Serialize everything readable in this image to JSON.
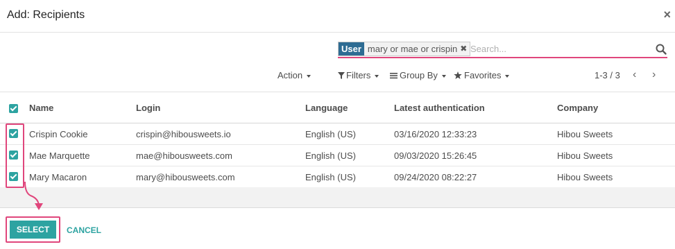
{
  "dialog": {
    "title": "Add: Recipients",
    "close_glyph": "×"
  },
  "search": {
    "facet_label": "User",
    "facet_values": "mary or mae or crispin",
    "facet_remove_glyph": "✖",
    "placeholder": "Search..."
  },
  "controls": {
    "action": "Action",
    "filters": "Filters",
    "group_by": "Group By",
    "favorites": "Favorites",
    "pager": "1-3 / 3",
    "prev_glyph": "‹",
    "next_glyph": "›"
  },
  "table": {
    "columns": [
      "Name",
      "Login",
      "Language",
      "Latest authentication",
      "Company"
    ],
    "rows": [
      {
        "name": "Crispin Cookie",
        "login": "crispin@hibousweets.io",
        "language": "English (US)",
        "latest_auth": "03/16/2020 12:33:23",
        "company": "Hibou Sweets",
        "checked": true
      },
      {
        "name": "Mae Marquette",
        "login": "mae@hibousweets.com",
        "language": "English (US)",
        "latest_auth": "09/03/2020 15:26:45",
        "company": "Hibou Sweets",
        "checked": true
      },
      {
        "name": "Mary Macaron",
        "login": "mary@hibousweets.com",
        "language": "English (US)",
        "latest_auth": "09/24/2020 08:22:27",
        "company": "Hibou Sweets",
        "checked": true
      }
    ]
  },
  "footer": {
    "select_label": "SELECT",
    "cancel_label": "CANCEL"
  },
  "colors": {
    "accent": "#2da3a1",
    "highlight": "#e0467c",
    "facet": "#2e6c93"
  }
}
